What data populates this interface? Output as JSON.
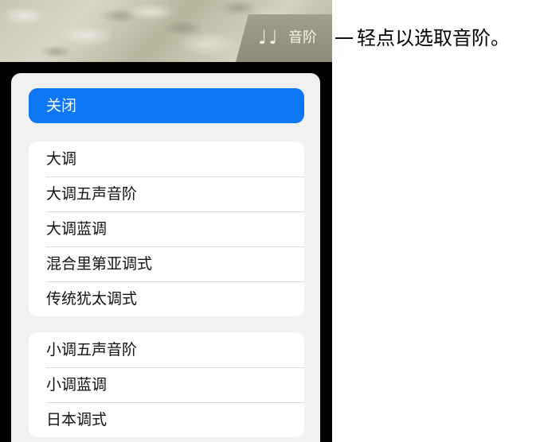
{
  "header": {
    "tab_icon": "music-notes-icon",
    "tab_icon_glyph": "♩♩",
    "tab_label": "音阶"
  },
  "callout": {
    "text": "轻点以选取音阶。"
  },
  "menu": {
    "close_label": "关闭",
    "groups": [
      {
        "items": [
          "大调",
          "大调五声音阶",
          "大调蓝调",
          "混合里第亚调式",
          "传统犹太调式"
        ]
      },
      {
        "items": [
          "小调五声音阶",
          "小调蓝调",
          "日本调式"
        ]
      }
    ]
  },
  "colors": {
    "accent": "#0d76f4",
    "panel_background": "#f1f1f4",
    "device_body": "#000000"
  }
}
